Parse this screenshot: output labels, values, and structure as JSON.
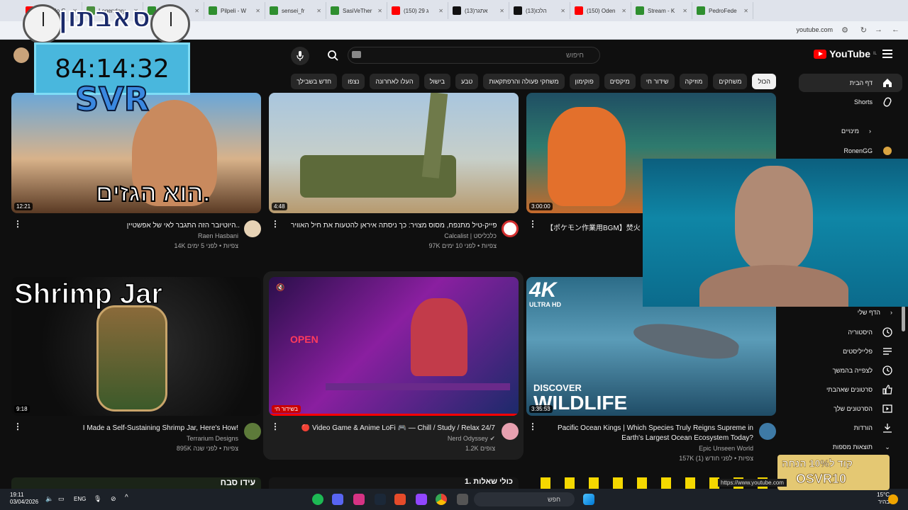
{
  "browser": {
    "tabs": [
      {
        "label": "(150) No G",
        "color": "#ff0000"
      },
      {
        "label": "Legendary",
        "color": "#4a8f3f"
      },
      {
        "label": "sensei_fr",
        "color": "#2f8f2f"
      },
      {
        "label": "Pilpeli - W",
        "color": "#2f8f2f"
      },
      {
        "label": "sensei_fr",
        "color": "#2f8f2f"
      },
      {
        "label": "SasiVeTher",
        "color": "#2f8f2f"
      },
      {
        "label": "(150) 29 ג",
        "color": "#ff0000"
      },
      {
        "label": "(13)אתגר",
        "color": "#111111"
      },
      {
        "label": "(13)הלכו",
        "color": "#111111"
      },
      {
        "label": "(150) Oden",
        "color": "#ff0000"
      },
      {
        "label": "Stream - K",
        "color": "#2f8f2f"
      },
      {
        "label": "PedroFede",
        "color": "#2f8f2f"
      }
    ],
    "url": "youtube.com"
  },
  "overlay": {
    "logo_text": "סאבתון",
    "timer": "84:14:32",
    "tag": "SVR",
    "promo_line1": "קוד ל10% הנחה",
    "promo_line2": "OSVR10"
  },
  "header": {
    "logo": "YouTube",
    "logo_sup": "IL",
    "search_placeholder": "חיפוש"
  },
  "chips": [
    "הכול",
    "משחקים",
    "מוזיקה",
    "שידור חי",
    "מיקסים",
    "פוקימון",
    "משחקי פעולה והרפתקאות",
    "טבע",
    "בישול",
    "העלו לאחרונה",
    "נצפו",
    "חדש בשבילך"
  ],
  "sidebar": {
    "home": "דף הבית",
    "shorts": "Shorts",
    "subscriptions": "מינויים",
    "sub_channel": "RonenGG",
    "you": "הדף שלי",
    "items": [
      "היסטוריה",
      "פלייליסטים",
      "לצפייה בהמשך",
      "סרטונים שאהבתי",
      "הסרטונים שלך",
      "הורדות",
      "תוצאות מספות"
    ]
  },
  "videos": [
    {
      "title": "היוטיובר הזה התגבר לאי של אפשטיין..",
      "channel": "Raen Hasbani",
      "meta": "14K צפיות • לפני 5 ימים",
      "duration": "12:21",
      "thumb_text": "הוא הגזים."
    },
    {
      "title": "פייק-טיל מתנפח, מסוס מצויר: כך ניסתה איראן להטעות את חיל האוויר",
      "channel": "Calcalist | כלכליסט",
      "meta": "97K צפיות • לפני 10 ימים",
      "duration": "4:48"
    },
    {
      "title": "【ポケモン作業用BGM】焚火",
      "channel": "",
      "meta": "",
      "duration": "3:00:00"
    },
    {
      "title": "I Made a Self-Sustaining Shrimp Jar, Here's How!",
      "channel": "Terrarium Designs",
      "meta": "895K צפיות • לפני שנה",
      "duration": "9:18",
      "thumb_text": "Shrimp Jar"
    },
    {
      "title": "🔴 Video Game & Anime LoFi 🎮 — Chill / Study / Relax 24/7",
      "channel": "Nerd Odyssey",
      "meta": "1.2K צופים",
      "duration": "בשידור חי",
      "thumb_text": "OPEN"
    },
    {
      "title": "Pacific Ocean Kings | Which Species Truly Reigns Supreme in",
      "title2": "Earth's Largest Ocean Ecosystem Today?",
      "channel": "Epic Unseen World",
      "meta": "157K צפיות • לפני חודש (1)",
      "duration": "3:35:53",
      "thumb_text": "WILDLIFE",
      "thumb_top": "DISCOVER",
      "thumb_badge": "4K",
      "thumb_badge2": "ULTRA HD"
    }
  ],
  "bottom_row_texts": [
    "עידו סבח",
    "1. כולי שאלות"
  ],
  "url_tooltip": "https://www.youtube.com",
  "taskbar": {
    "time": "19:11",
    "date": "03/04/2026",
    "lang": "ENG",
    "search": "חפש",
    "temp": "15°C",
    "weather": "בהיר"
  }
}
